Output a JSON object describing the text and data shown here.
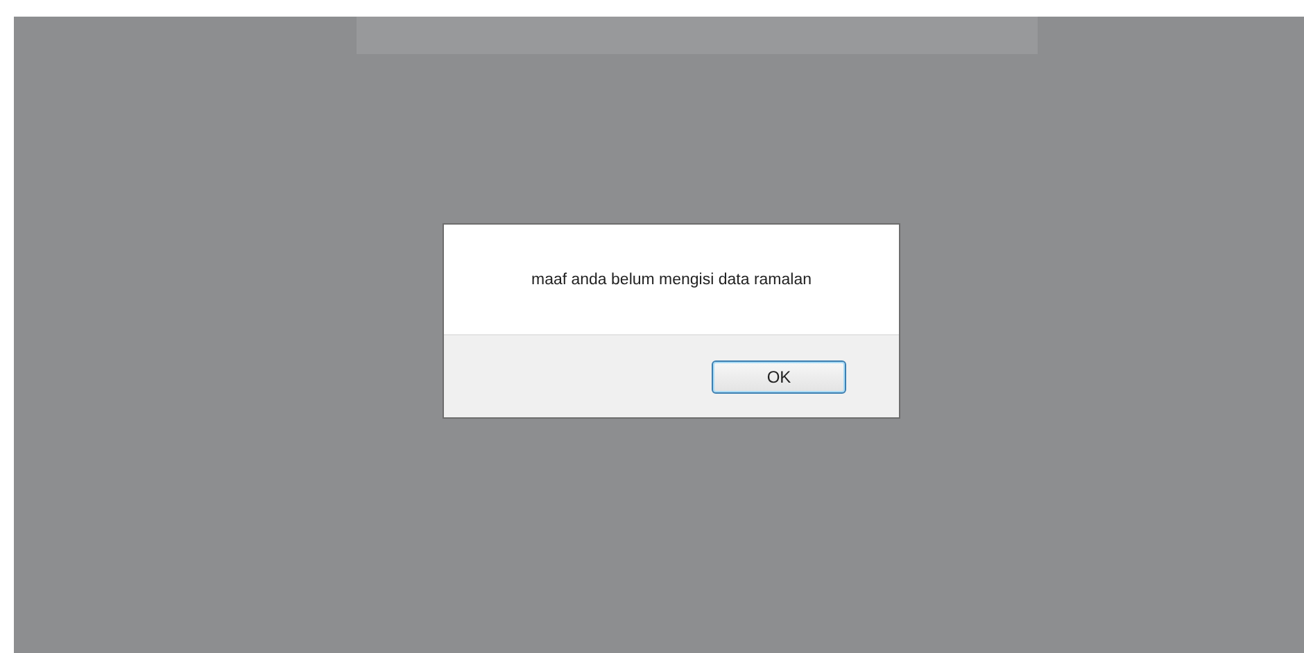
{
  "dialog": {
    "message": "maaf anda belum mengisi data ramalan",
    "buttons": [
      {
        "label": "OK",
        "selected": true
      }
    ]
  }
}
